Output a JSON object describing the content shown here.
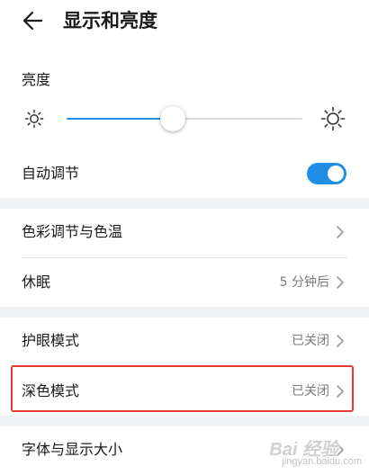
{
  "header": {
    "title": "显示和亮度",
    "back_icon": "back-arrow-icon"
  },
  "brightness": {
    "label": "亮度",
    "level": 0.45,
    "accent": "#1f8fe6",
    "min_icon": "sun-small-icon",
    "max_icon": "sun-large-icon"
  },
  "auto_adjust": {
    "label": "自动调节",
    "on": true
  },
  "rows": [
    {
      "label": "色彩调节与色温",
      "value": ""
    },
    {
      "label": "休眠",
      "value": "5 分钟后"
    },
    {
      "label": "护眼模式",
      "value": "已关闭"
    },
    {
      "label": "深色模式",
      "value": "已关闭"
    },
    {
      "label": "字体与显示大小",
      "value": ""
    }
  ],
  "highlight_color": "#e53935",
  "watermark": {
    "brand": "Bai 经验",
    "url": "jingyan.baidu.com"
  }
}
